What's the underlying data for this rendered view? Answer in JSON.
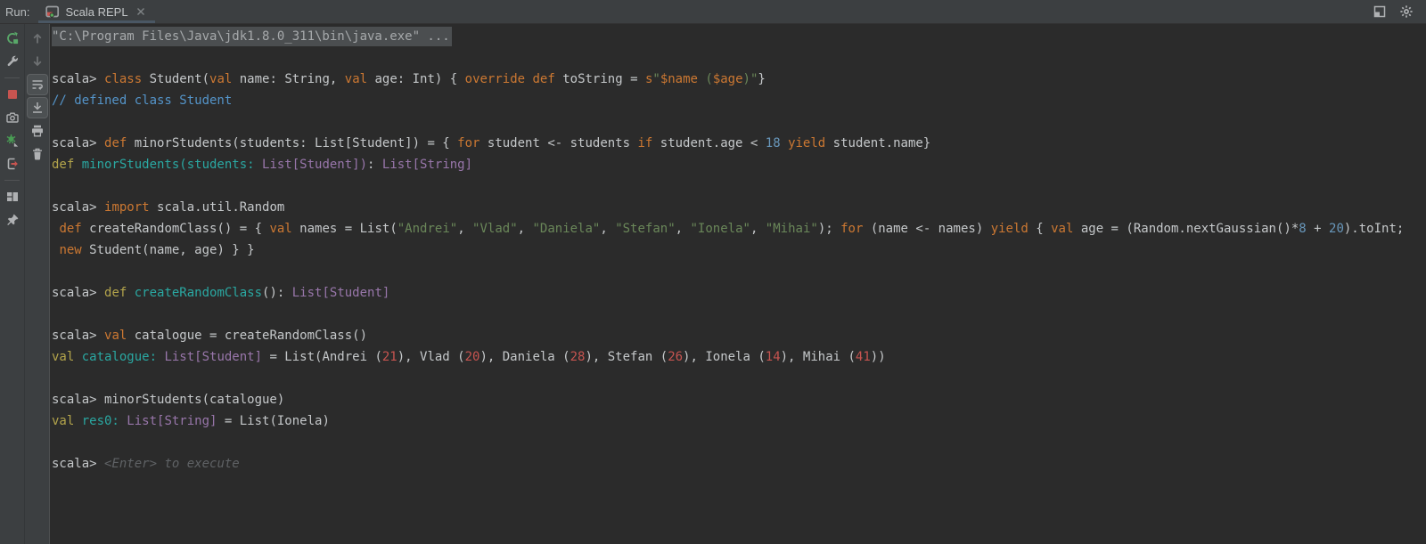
{
  "topbar": {
    "run_label": "Run:",
    "tab": {
      "icon": "run-console",
      "title": "Scala REPL",
      "close_icon": "close"
    },
    "right_icons": [
      "float-window",
      "gear"
    ]
  },
  "toolbar_primary": [
    {
      "icon": "rerun"
    },
    {
      "icon": "wrench"
    },
    {
      "divider": true
    },
    {
      "icon": "stop"
    },
    {
      "icon": "camera"
    },
    {
      "icon": "attach"
    },
    {
      "icon": "exit"
    },
    {
      "divider": true
    },
    {
      "icon": "layout"
    },
    {
      "icon": "pin"
    }
  ],
  "toolbar_secondary": [
    {
      "icon": "arrow-up"
    },
    {
      "icon": "arrow-down"
    },
    {
      "icon": "soft-wrap",
      "selected": true
    },
    {
      "icon": "scroll-end",
      "selected": true
    },
    {
      "icon": "printer"
    },
    {
      "icon": "trash"
    }
  ],
  "palette": {
    "bar": "#3c3f41",
    "console": "#2b2b2b",
    "text": "#c5c8ca",
    "kw": "#cc7832",
    "str": "#6a8759",
    "num": "#6897bb",
    "info": "#5494c9",
    "ykw": "#b3a44b",
    "teal": "#2aa8a2",
    "typ": "#9876aa",
    "rnum": "#c75450",
    "hint": "#5f6265",
    "selbg": "#4b4e50",
    "seltx": "#a6a9ab",
    "icon": "#afb1b3",
    "icondim": "#6e7173",
    "green": "#59a869",
    "red": "#c75450",
    "underline": "#4a5764"
  },
  "console": {
    "lines": [
      {
        "s": [
          [
            "exe",
            "\"C:\\Program Files\\Java\\jdk1.8.0_311\\bin\\java.exe\" ..."
          ]
        ]
      },
      {
        "s": []
      },
      {
        "s": [
          [
            "d",
            "scala> "
          ],
          [
            "kw",
            "class "
          ],
          [
            "d",
            "Student("
          ],
          [
            "kw",
            "val "
          ],
          [
            "d",
            "name: String, "
          ],
          [
            "kw",
            "val "
          ],
          [
            "d",
            "age: Int) { "
          ],
          [
            "kw",
            "override "
          ],
          [
            "kw",
            "def "
          ],
          [
            "d",
            "toString = "
          ],
          [
            "kw",
            "s"
          ],
          [
            "str",
            "\""
          ],
          [
            "kw",
            "$name"
          ],
          [
            "str",
            " ("
          ],
          [
            "kw",
            "$age"
          ],
          [
            "str",
            ")\""
          ],
          [
            "d",
            "}"
          ]
        ]
      },
      {
        "s": [
          [
            "cmt",
            "// defined class Student"
          ]
        ]
      },
      {
        "s": []
      },
      {
        "s": [
          [
            "d",
            "scala> "
          ],
          [
            "kw",
            "def "
          ],
          [
            "d",
            "minorStudents(students: List[Student]) = { "
          ],
          [
            "kw",
            "for "
          ],
          [
            "d",
            "student <- students "
          ],
          [
            "kw",
            "if "
          ],
          [
            "d",
            "student.age < "
          ],
          [
            "num",
            "18"
          ],
          [
            "d",
            " "
          ],
          [
            "kw",
            "yield "
          ],
          [
            "d",
            "student.name}"
          ]
        ]
      },
      {
        "s": [
          [
            "ykw",
            "def "
          ],
          [
            "id",
            "minorStudents(students: "
          ],
          [
            "typ",
            "List[Student])"
          ],
          [
            "d",
            ": "
          ],
          [
            "typ",
            "List[String]"
          ]
        ]
      },
      {
        "s": []
      },
      {
        "s": [
          [
            "d",
            "scala> "
          ],
          [
            "kw",
            "import "
          ],
          [
            "d",
            "scala.util.Random"
          ]
        ]
      },
      {
        "s": [
          [
            "d",
            " "
          ],
          [
            "kw",
            "def "
          ],
          [
            "d",
            "createRandomClass() = { "
          ],
          [
            "kw",
            "val "
          ],
          [
            "d",
            "names = List("
          ],
          [
            "str",
            "\"Andrei\""
          ],
          [
            "d",
            ", "
          ],
          [
            "str",
            "\"Vlad\""
          ],
          [
            "d",
            ", "
          ],
          [
            "str",
            "\"Daniela\""
          ],
          [
            "d",
            ", "
          ],
          [
            "str",
            "\"Stefan\""
          ],
          [
            "d",
            ", "
          ],
          [
            "str",
            "\"Ionela\""
          ],
          [
            "d",
            ", "
          ],
          [
            "str",
            "\"Mihai\""
          ],
          [
            "d",
            "); "
          ],
          [
            "kw",
            "for "
          ],
          [
            "d",
            "(name <- names) "
          ],
          [
            "kw",
            "yield "
          ],
          [
            "d",
            "{ "
          ],
          [
            "kw",
            "val "
          ],
          [
            "d",
            "age = (Random.nextGaussian()*"
          ],
          [
            "num",
            "8"
          ],
          [
            "d",
            " + "
          ],
          [
            "num",
            "20"
          ],
          [
            "d",
            ").toInt;"
          ]
        ]
      },
      {
        "s": [
          [
            "d",
            " "
          ],
          [
            "kw",
            "new "
          ],
          [
            "d",
            "Student(name, age) } }"
          ]
        ]
      },
      {
        "s": []
      },
      {
        "s": [
          [
            "d",
            "scala> "
          ],
          [
            "ykw",
            "def "
          ],
          [
            "id",
            "createRandomClass"
          ],
          [
            "d",
            "(): "
          ],
          [
            "typ",
            "List[Student]"
          ]
        ]
      },
      {
        "s": []
      },
      {
        "s": [
          [
            "d",
            "scala> "
          ],
          [
            "kw",
            "val "
          ],
          [
            "d",
            "catalogue = createRandomClass()"
          ]
        ]
      },
      {
        "s": [
          [
            "ykw",
            "val "
          ],
          [
            "id",
            "catalogue: "
          ],
          [
            "typ",
            "List[Student]"
          ],
          [
            "d",
            " = List(Andrei ("
          ],
          [
            "rnum",
            "21"
          ],
          [
            "d",
            "), Vlad ("
          ],
          [
            "rnum",
            "20"
          ],
          [
            "d",
            "), Daniela ("
          ],
          [
            "rnum",
            "28"
          ],
          [
            "d",
            "), Stefan ("
          ],
          [
            "rnum",
            "26"
          ],
          [
            "d",
            "), Ionela ("
          ],
          [
            "rnum",
            "14"
          ],
          [
            "d",
            "), Mihai ("
          ],
          [
            "rnum",
            "41"
          ],
          [
            "d",
            "))"
          ]
        ]
      },
      {
        "s": []
      },
      {
        "s": [
          [
            "d",
            "scala> minorStudents(catalogue)"
          ]
        ]
      },
      {
        "s": [
          [
            "ykw",
            "val "
          ],
          [
            "id",
            "res0: "
          ],
          [
            "typ",
            "List[String]"
          ],
          [
            "d",
            " = List(Ionela)"
          ]
        ]
      },
      {
        "s": []
      },
      {
        "s": [
          [
            "d",
            "scala> "
          ],
          [
            "hint",
            "<Enter> to execute"
          ]
        ]
      }
    ]
  }
}
